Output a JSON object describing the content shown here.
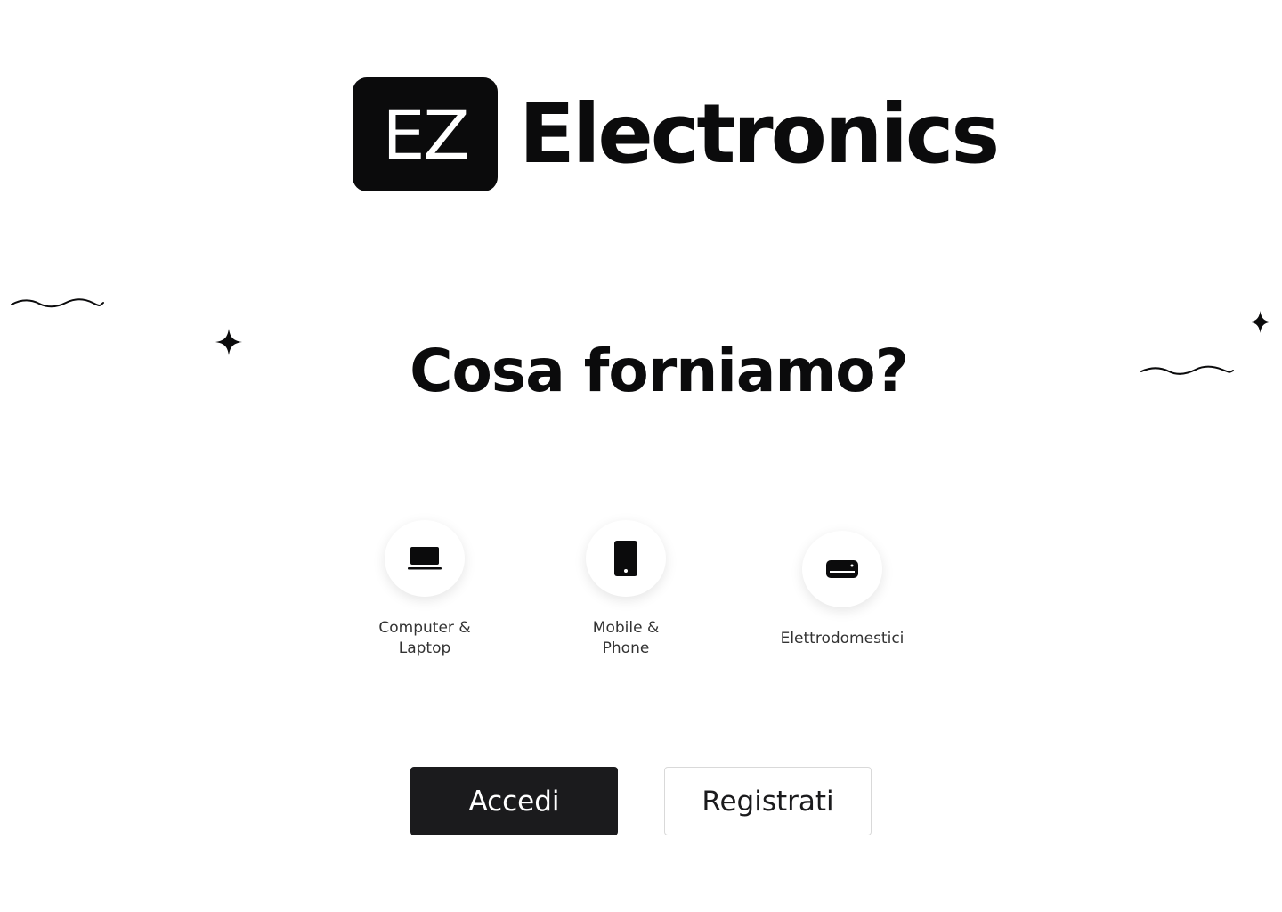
{
  "logo": {
    "badge_text": "EZ",
    "word": "Electronics"
  },
  "heading": "Cosa forniamo?",
  "categories": [
    {
      "icon": "laptop-icon",
      "label": "Computer & Laptop"
    },
    {
      "icon": "smartphone-icon",
      "label": "Mobile & Phone"
    },
    {
      "icon": "appliance-icon",
      "label": "Elettrodomestici"
    }
  ],
  "actions": {
    "login_label": "Accedi",
    "register_label": "Registrati"
  },
  "colors": {
    "primary": "#1b1b1d",
    "background": "#ffffff",
    "text": "#0b0b0c"
  }
}
